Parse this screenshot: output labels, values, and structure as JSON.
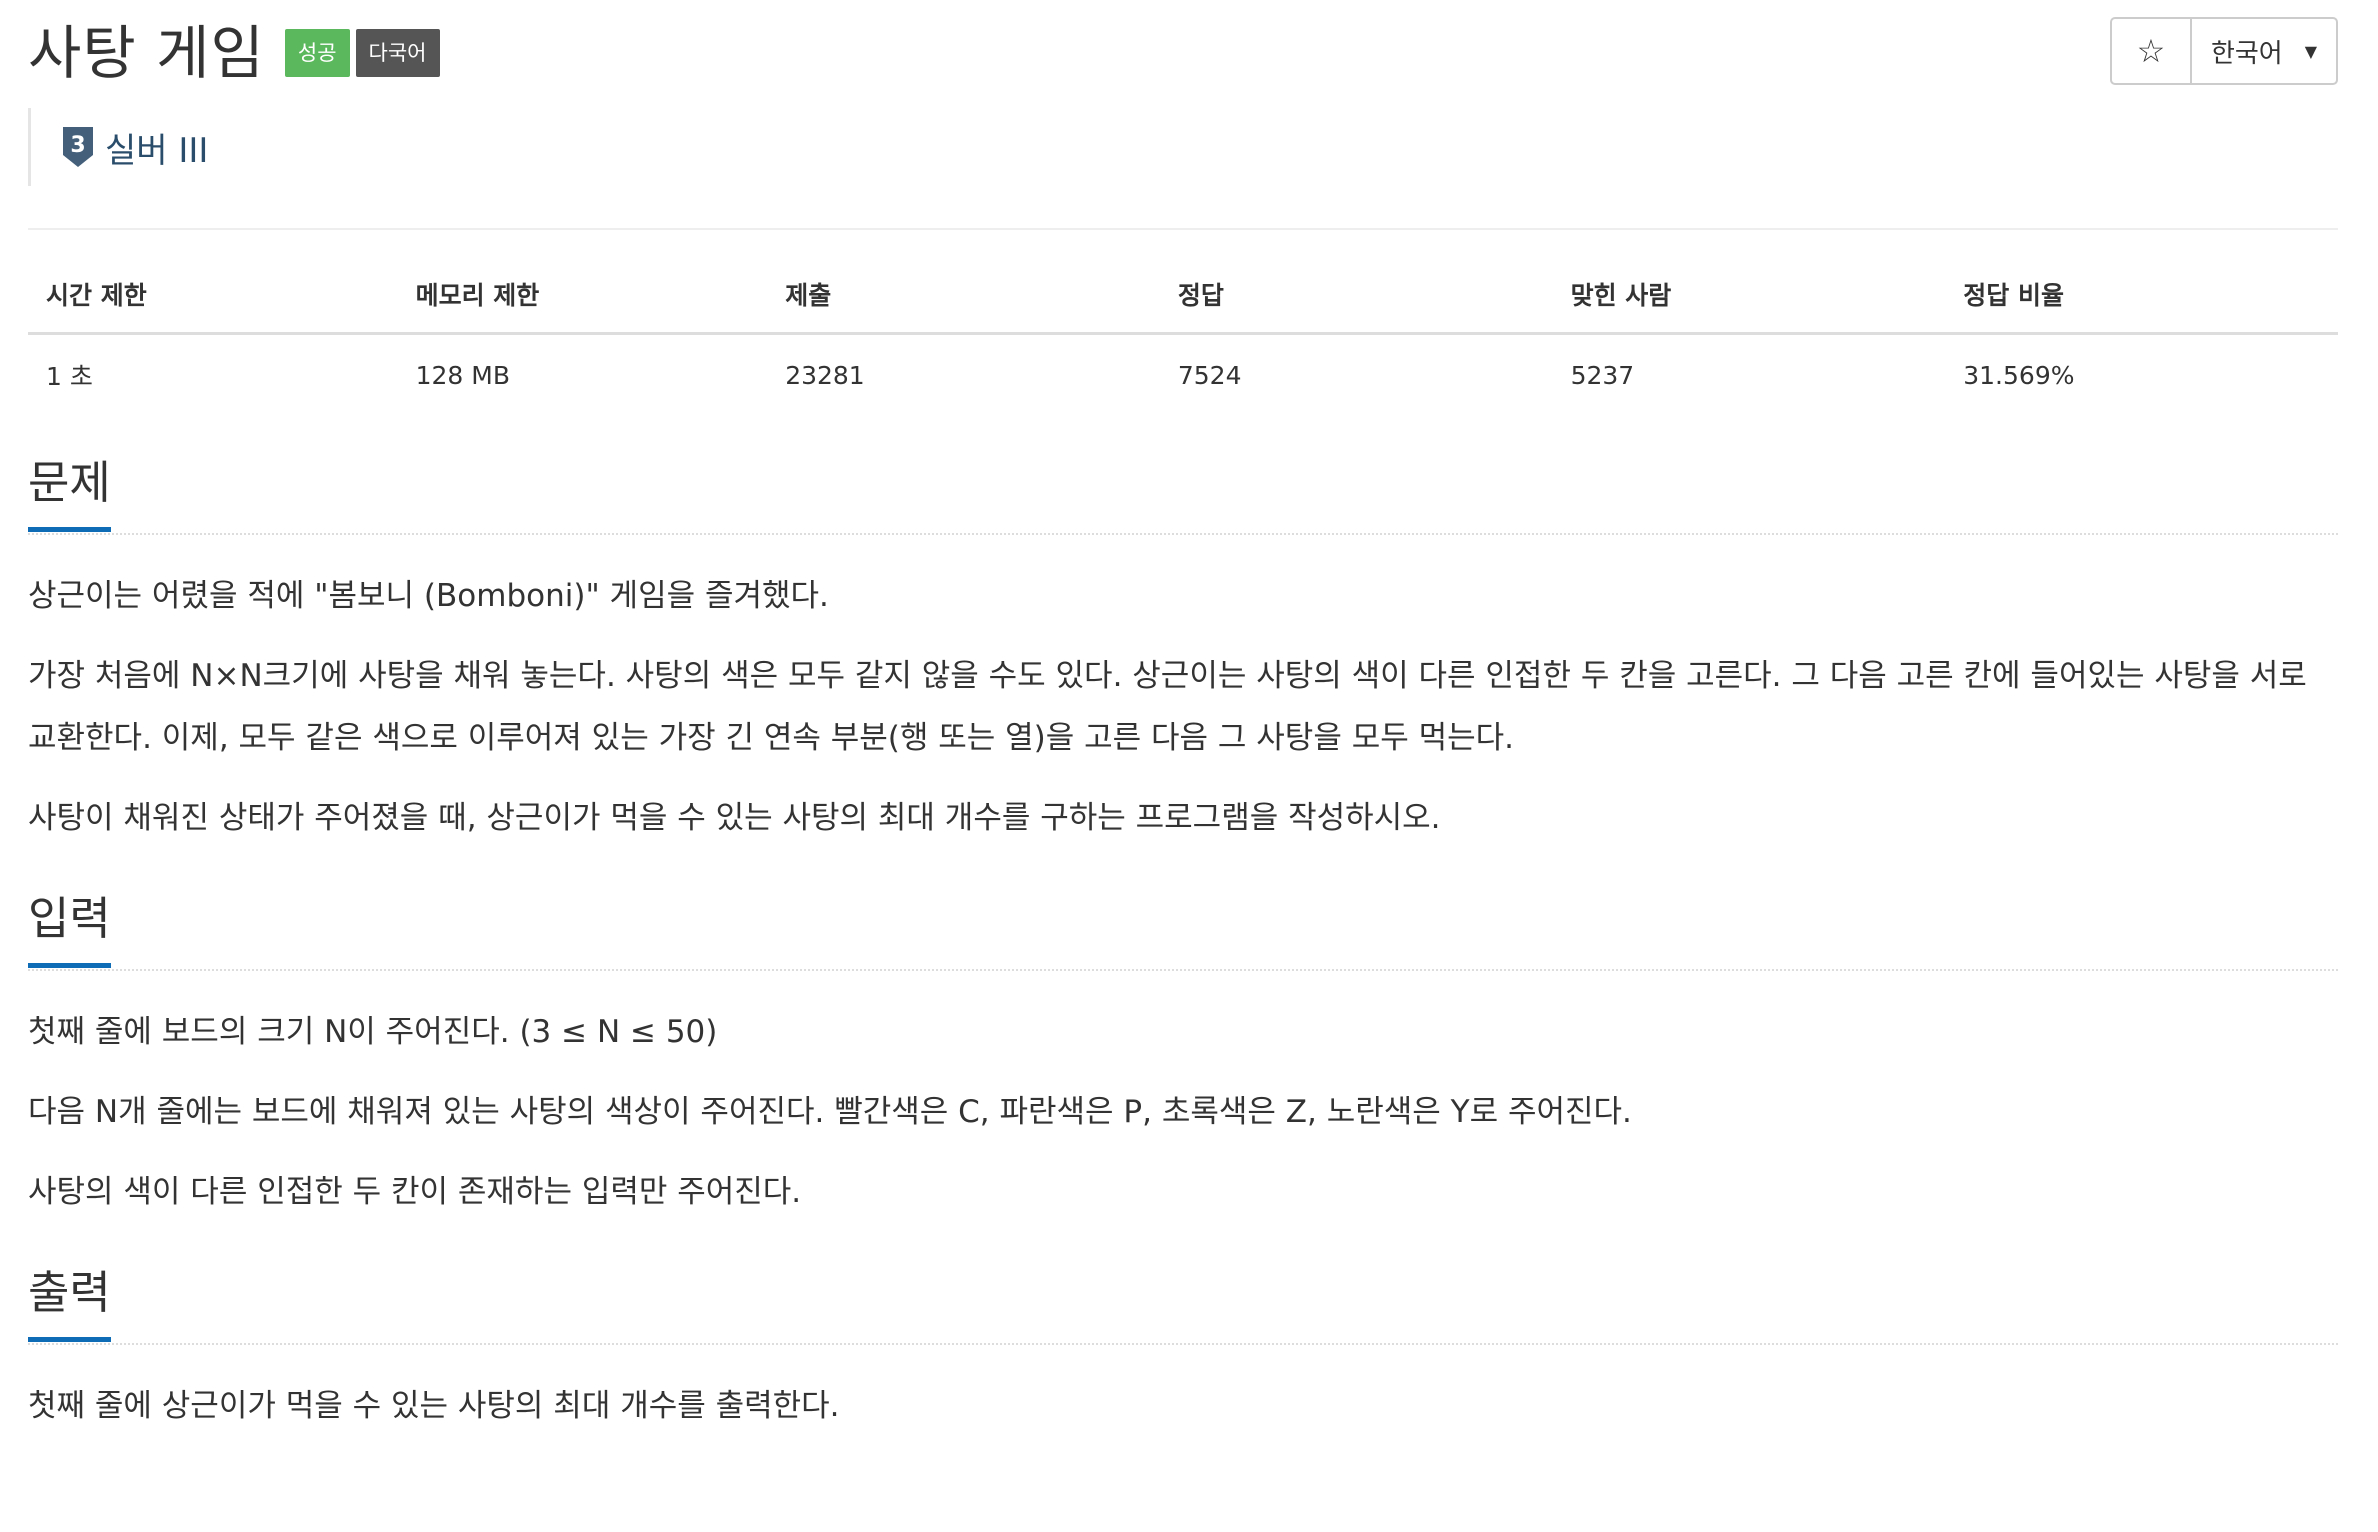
{
  "problem": {
    "title": "사탕 게임",
    "labels": [
      {
        "text": "성공",
        "color": "#5cb85c"
      },
      {
        "text": "다국어",
        "color": "#555555"
      }
    ],
    "tier": {
      "text": "실버 III",
      "badge_number": "3",
      "color": "#435f7a"
    }
  },
  "controls": {
    "star_icon": "☆",
    "language": "한국어",
    "caret_icon": "▼"
  },
  "info_table": {
    "headers": [
      "시간 제한",
      "메모리 제한",
      "제출",
      "정답",
      "맞힌 사람",
      "정답 비율"
    ],
    "values": [
      "1 초",
      "128 MB",
      "23281",
      "7524",
      "5237",
      "31.569%"
    ]
  },
  "sections": {
    "description": {
      "title": "문제",
      "paragraphs": [
        "상근이는 어렸을 적에 \"봄보니 (Bomboni)\" 게임을 즐겨했다.",
        "가장 처음에 N×N크기에 사탕을 채워 놓는다. 사탕의 색은 모두 같지 않을 수도 있다. 상근이는 사탕의 색이 다른 인접한 두 칸을 고른다. 그 다음 고른 칸에 들어있는 사탕을 서로 교환한다. 이제, 모두 같은 색으로 이루어져 있는 가장 긴 연속 부분(행 또는 열)을 고른 다음 그 사탕을 모두 먹는다.",
        "사탕이 채워진 상태가 주어졌을 때, 상근이가 먹을 수 있는 사탕의 최대 개수를 구하는 프로그램을 작성하시오."
      ]
    },
    "input": {
      "title": "입력",
      "paragraphs": [
        "첫째 줄에 보드의 크기 N이 주어진다. (3 ≤ N ≤ 50)",
        "다음 N개 줄에는 보드에 채워져 있는 사탕의 색상이 주어진다. 빨간색은 C, 파란색은 P, 초록색은 Z, 노란색은 Y로 주어진다.",
        "사탕의 색이 다른 인접한 두 칸이 존재하는 입력만 주어진다."
      ]
    },
    "output": {
      "title": "출력",
      "paragraphs": [
        "첫째 줄에 상근이가 먹을 수 있는 사탕의 최대 개수를 출력한다."
      ]
    }
  },
  "theme": {
    "section_underline": "#0d6cb5",
    "tier_text": "#2a4d6b"
  }
}
